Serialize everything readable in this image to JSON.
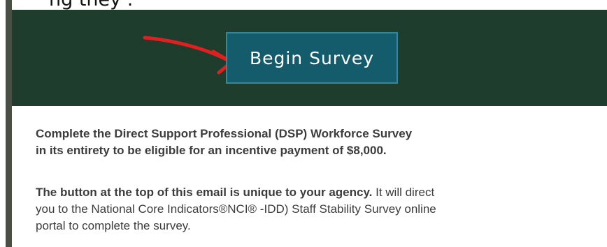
{
  "header_clip": {
    "text": "ng they         ."
  },
  "banner": {
    "button_label": "Begin Survey",
    "background_color": "#1f3d2d",
    "button_color": "#145c6c",
    "annotation": {
      "icon": "red-arrow-icon",
      "color": "#e02020"
    }
  },
  "content": {
    "paragraph1": {
      "line1": "Complete the Direct Support Professional (DSP) Workforce Survey",
      "line2": "in its entirety to be eligible for an incentive payment of $8,000."
    },
    "paragraph2": {
      "bold_text": "The button at the top of this email is unique to your agency.",
      "line1_rest": " It will direct",
      "line2": "you to the National Core Indicators®NCI® -IDD) Staff Stability Survey online",
      "line3": "portal to complete the survey."
    }
  }
}
